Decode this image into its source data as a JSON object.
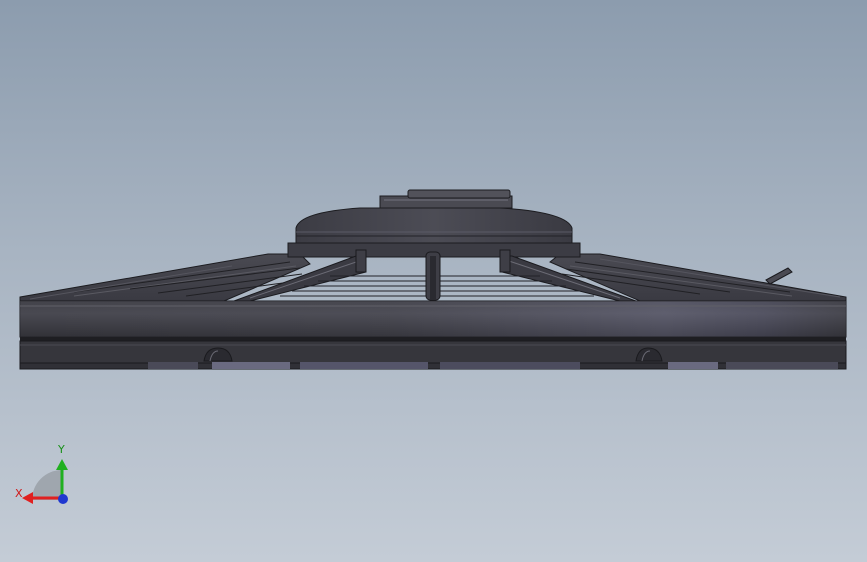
{
  "viewport": {
    "model": "fan-shroud-assembly"
  },
  "triad": {
    "x_label": "X",
    "y_label": "Y",
    "x_color": "#e02020",
    "y_color": "#20b020",
    "z_color": "#1f38d0"
  }
}
